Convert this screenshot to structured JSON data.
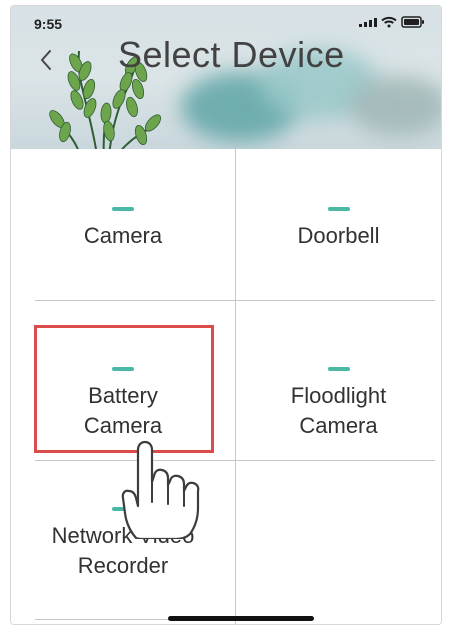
{
  "status_bar": {
    "time": "9:55"
  },
  "header": {
    "title": "Select Device",
    "back_icon": "chevron-left-icon"
  },
  "devices": [
    {
      "label": "Camera",
      "selected": false
    },
    {
      "label": "Doorbell",
      "selected": false
    },
    {
      "label": "Battery\nCamera",
      "selected": true
    },
    {
      "label": "Floodlight\nCamera",
      "selected": false
    },
    {
      "label": "Network Video\nRecorder",
      "selected": false
    }
  ],
  "colors": {
    "accent": "#4bb7a6",
    "highlight": "#dc4b4b",
    "title_text": "#424242"
  }
}
